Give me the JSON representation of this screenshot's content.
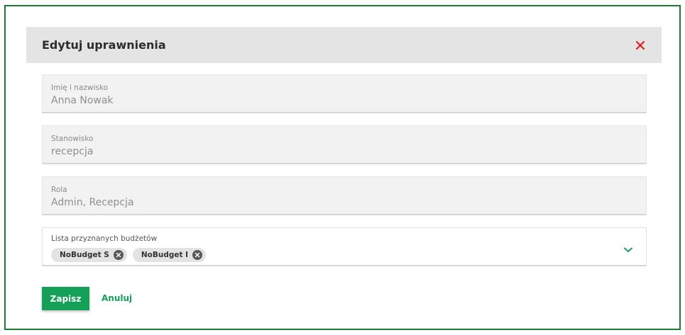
{
  "modal": {
    "title": "Edytuj uprawnienia",
    "close_icon": "close-icon",
    "close_color": "#e0201c"
  },
  "fields": {
    "name": {
      "label": "Imię i nazwisko",
      "value": "Anna Nowak"
    },
    "position": {
      "label": "Stanowisko",
      "value": "recepcja"
    },
    "role": {
      "label": "Rola",
      "value": "Admin, Recepcja"
    }
  },
  "budgets": {
    "label": "Lista przyznanych budżetów",
    "chips": [
      {
        "label": "NoBudget S"
      },
      {
        "label": "NoBudget I"
      }
    ],
    "dropdown_icon": "chevron-down-icon"
  },
  "actions": {
    "save_label": "Zapisz",
    "cancel_label": "Anuluj"
  },
  "colors": {
    "accent": "#14a057",
    "frame": "#1e7a37",
    "header_bg": "#e4e4e4"
  }
}
